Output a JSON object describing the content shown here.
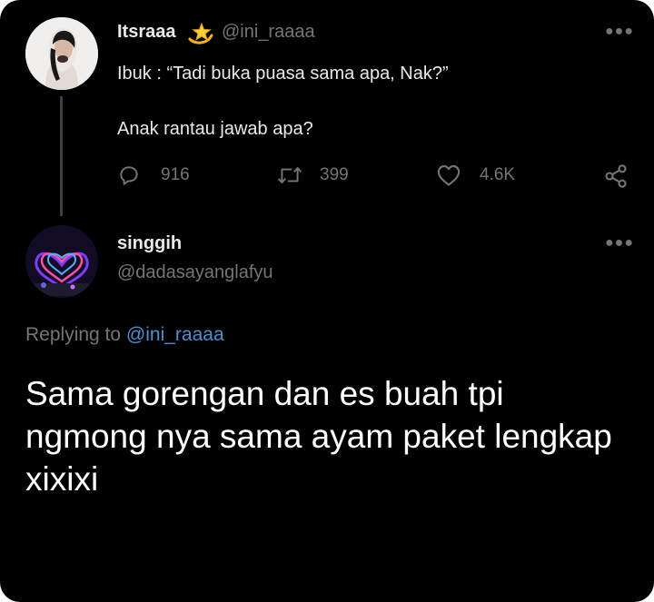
{
  "tweet": {
    "display_name": "Itsraaa",
    "badge_icon": "dizzy-star-emoji-icon",
    "handle": "@ini_raaaa",
    "line1": "Ibuk : “Tadi buka puasa sama apa, Nak?”",
    "line2": "Anak rantau jawab apa?",
    "replies": "916",
    "retweets": "399",
    "likes": "4.6K"
  },
  "reply": {
    "display_name": "singgih",
    "handle": "@dadasayanglafyu",
    "replying_prefix": "Replying to",
    "replying_to": "@ini_raaaa",
    "text": "Sama gorengan dan es buah tpi ngmong nya sama ayam paket lengkap xixixi"
  },
  "icons": {
    "reply": "reply-bubble-icon",
    "retweet": "retweet-icon",
    "like": "heart-icon",
    "share": "share-icon",
    "more": "more-dots-icon"
  },
  "colors": {
    "background": "#000000",
    "text": "#e7e9ea",
    "muted": "#71767b",
    "link": "#4d8fd1",
    "thread_line": "#3d4146"
  }
}
